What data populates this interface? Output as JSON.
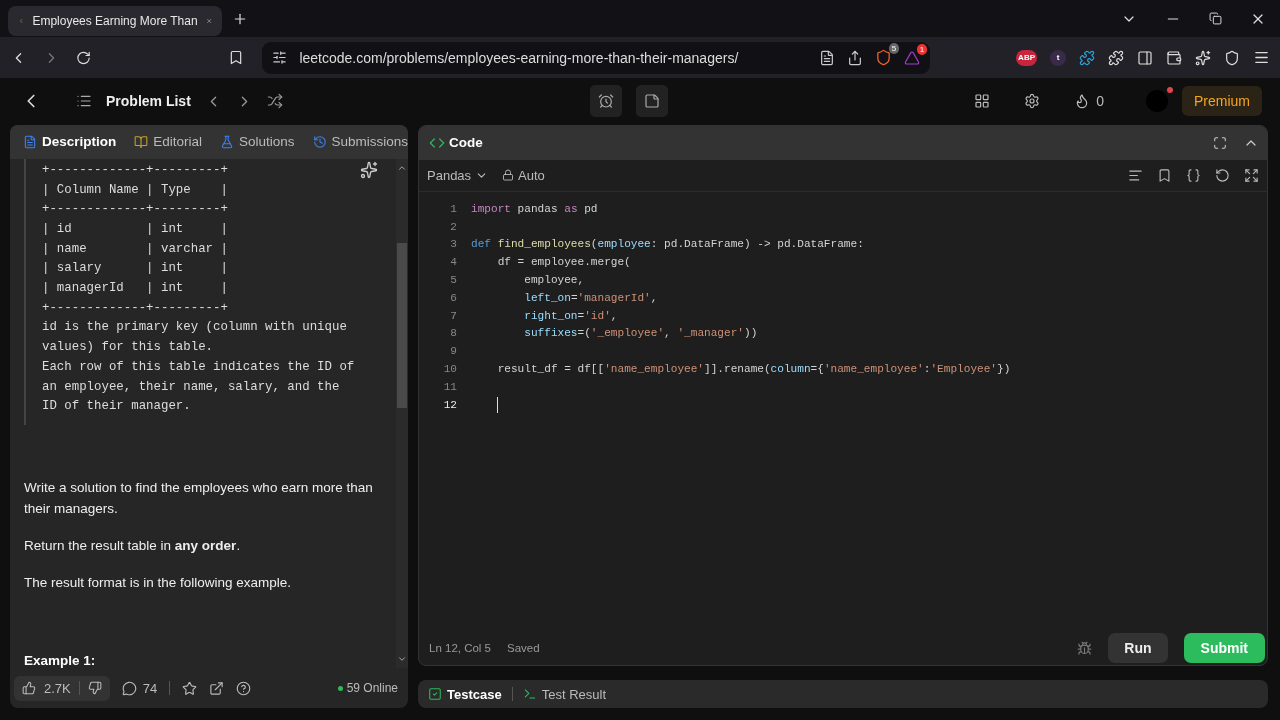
{
  "browser": {
    "tab_title": "Employees Earning More Than",
    "url": "leetcode.com/problems/employees-earning-more-than-their-managers/",
    "shield_badge": "5",
    "alert_badge": "1",
    "extensions": [
      {
        "kind": "abp",
        "label": "ABP"
      },
      {
        "kind": "t",
        "label": "t"
      }
    ]
  },
  "nav": {
    "problem_list": "Problem List",
    "streak": "0",
    "premium": "Premium"
  },
  "left_tabs": [
    {
      "label": "Description",
      "kind": "description",
      "selected": true
    },
    {
      "label": "Editorial",
      "kind": "editorial",
      "selected": false
    },
    {
      "label": "Solutions",
      "kind": "solutions",
      "selected": false
    },
    {
      "label": "Submissions",
      "kind": "submissions",
      "selected": false
    }
  ],
  "schema_lines": [
    "+-------------+---------+",
    "| Column Name | Type    |",
    "+-------------+---------+",
    "| id          | int     |",
    "| name        | varchar |",
    "| salary      | int     |",
    "| managerId   | int     |",
    "+-------------+---------+"
  ],
  "schema_notes": [
    "id is the primary key (column with unique values) for this table.",
    "Each row of this table indicates the ID of an employee, their name, salary, and the ID of their manager."
  ],
  "paragraphs": [
    "Write a solution to find the employees who earn more than their managers.",
    "Return the result table in **any order**.",
    "The result format is in the following example."
  ],
  "example_heading": "Example 1:",
  "footer": {
    "likes": "2.7K",
    "comments": "74",
    "online": "59 Online"
  },
  "code_panel": {
    "title": "Code",
    "language": "Pandas",
    "mode": "Auto",
    "status": "Ln 12, Col 5",
    "saved": "Saved",
    "run": "Run",
    "submit": "Submit"
  },
  "code_lines": [
    {
      "number": "1",
      "active": false,
      "tokens": [
        {
          "text": "import",
          "kind": "keyword"
        },
        {
          "text": " pandas ",
          "kind": "plain"
        },
        {
          "text": "as",
          "kind": "keyword"
        },
        {
          "text": " pd",
          "kind": "plain"
        }
      ]
    },
    {
      "number": "2",
      "active": false
    },
    {
      "number": "3",
      "active": false,
      "tokens": [
        {
          "text": "def ",
          "kind": "def"
        },
        {
          "text": "find_employees",
          "kind": "function"
        },
        {
          "text": "(",
          "kind": "plain"
        },
        {
          "text": "employee",
          "kind": "param"
        },
        {
          "text": ": pd.DataFrame) -> pd.DataFrame:",
          "kind": "plain"
        }
      ]
    },
    {
      "number": "4",
      "active": false,
      "tokens": [
        {
          "text": "    df = employee.merge(",
          "kind": "plain"
        }
      ]
    },
    {
      "number": "5",
      "active": false,
      "tokens": [
        {
          "text": "        employee,",
          "kind": "plain"
        }
      ]
    },
    {
      "number": "6",
      "active": false,
      "tokens": [
        {
          "text": "        left_on",
          "kind": "param"
        },
        {
          "text": "=",
          "kind": "plain"
        },
        {
          "text": "'managerId'",
          "kind": "string"
        },
        {
          "text": ",",
          "kind": "plain"
        }
      ]
    },
    {
      "number": "7",
      "active": false,
      "tokens": [
        {
          "text": "        right_on",
          "kind": "param"
        },
        {
          "text": "=",
          "kind": "plain"
        },
        {
          "text": "'id'",
          "kind": "string"
        },
        {
          "text": ",",
          "kind": "plain"
        }
      ]
    },
    {
      "number": "8",
      "active": false,
      "tokens": [
        {
          "text": "        suffixes",
          "kind": "param"
        },
        {
          "text": "=(",
          "kind": "plain"
        },
        {
          "text": "'_employee'",
          "kind": "string"
        },
        {
          "text": ", ",
          "kind": "plain"
        },
        {
          "text": "'_manager'",
          "kind": "string"
        },
        {
          "text": "))",
          "kind": "plain"
        }
      ]
    },
    {
      "number": "9",
      "active": false
    },
    {
      "number": "10",
      "active": false,
      "tokens": [
        {
          "text": "    result_df = df[[",
          "kind": "plain"
        },
        {
          "text": "'name_employee'",
          "kind": "string"
        },
        {
          "text": "]].rename(",
          "kind": "plain"
        },
        {
          "text": "column",
          "kind": "param"
        },
        {
          "text": "={",
          "kind": "plain"
        },
        {
          "text": "'name_employee'",
          "kind": "string"
        },
        {
          "text": ":",
          "kind": "plain"
        },
        {
          "text": "'Employee'",
          "kind": "string"
        },
        {
          "text": "})",
          "kind": "plain"
        }
      ]
    },
    {
      "number": "11",
      "active": false
    },
    {
      "number": "12",
      "active": true
    }
  ],
  "bottom_tabs": [
    {
      "label": "Testcase",
      "kind": "testcase",
      "selected": true
    },
    {
      "label": "Test Result",
      "kind": "result",
      "selected": false
    }
  ]
}
